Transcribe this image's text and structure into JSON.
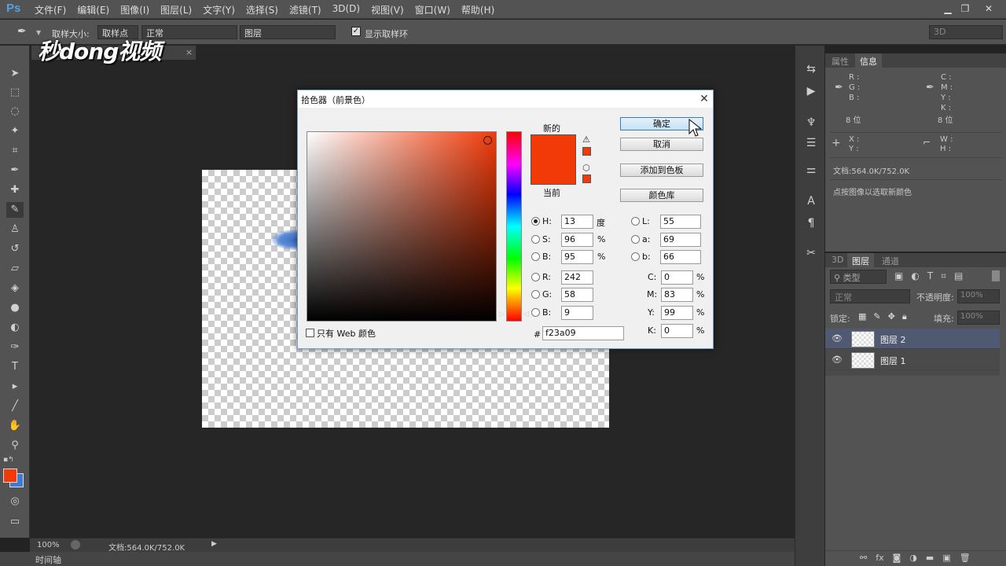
{
  "app": {
    "logo": "Ps"
  },
  "menu": [
    "文件(F)",
    "编辑(E)",
    "图像(I)",
    "图层(L)",
    "文字(Y)",
    "选择(S)",
    "滤镜(T)",
    "3D(D)",
    "视图(V)",
    "窗口(W)",
    "帮助(H)"
  ],
  "options": {
    "sample_size_label": "取样大小:",
    "sample_size": "取样点",
    "sample_mode": "正常",
    "layer_select": "图层",
    "show_ring": "显示取样环",
    "workspace": "3D"
  },
  "watermark": "秒dong视频",
  "colors": {
    "foreground": "#f23a09",
    "background": "#3d7bd4",
    "accent": "#4fa3e0"
  },
  "status": {
    "zoom": "100%",
    "doc": "文档:564.0K/752.0K"
  },
  "timeline": "时间轴",
  "info_panel": {
    "tabs": [
      "属性",
      "信息"
    ],
    "rgb_labels": [
      "R :",
      "G :",
      "B :"
    ],
    "cmyk_labels": [
      "C :",
      "M :",
      "Y :",
      "K :"
    ],
    "bits_left": "8 位",
    "bits_right": "8 位",
    "xy_labels": [
      "X :",
      "Y :"
    ],
    "wh_labels": [
      "W :",
      "H :"
    ],
    "doc": "文档:564.0K/752.0K",
    "hint": "点按图像以选取新颜色"
  },
  "layers_panel": {
    "tabs": [
      "3D",
      "图层",
      "通道"
    ],
    "filter_kind": "类型",
    "blend_mode": "正常",
    "opacity_label": "不透明度:",
    "opacity": "100%",
    "lock_label": "锁定:",
    "fill_label": "填充:",
    "fill": "100%",
    "layers": [
      {
        "name": "图层 2",
        "selected": true
      },
      {
        "name": "图层 1",
        "selected": false
      }
    ]
  },
  "dialog": {
    "title": "拾色器（前景色）",
    "new_label": "新的",
    "current_label": "当前",
    "buttons": {
      "ok": "确定",
      "cancel": "取消",
      "add_swatch": "添加到色板",
      "color_lib": "颜色库"
    },
    "hsb": [
      {
        "label": "H:",
        "value": "13",
        "unit": "度",
        "checked": true
      },
      {
        "label": "S:",
        "value": "96",
        "unit": "%"
      },
      {
        "label": "B:",
        "value": "95",
        "unit": "%"
      }
    ],
    "rgb": [
      {
        "label": "R:",
        "value": "242"
      },
      {
        "label": "G:",
        "value": "58"
      },
      {
        "label": "B:",
        "value": "9"
      }
    ],
    "lab": [
      {
        "label": "L:",
        "value": "55"
      },
      {
        "label": "a:",
        "value": "69"
      },
      {
        "label": "b:",
        "value": "66"
      }
    ],
    "cmyk": [
      {
        "label": "C:",
        "value": "0",
        "unit": "%"
      },
      {
        "label": "M:",
        "value": "83",
        "unit": "%"
      },
      {
        "label": "Y:",
        "value": "99",
        "unit": "%"
      },
      {
        "label": "K:",
        "value": "0",
        "unit": "%"
      }
    ],
    "hex_label": "#",
    "hex": "f23a09",
    "web_only": "只有 Web 颜色"
  }
}
